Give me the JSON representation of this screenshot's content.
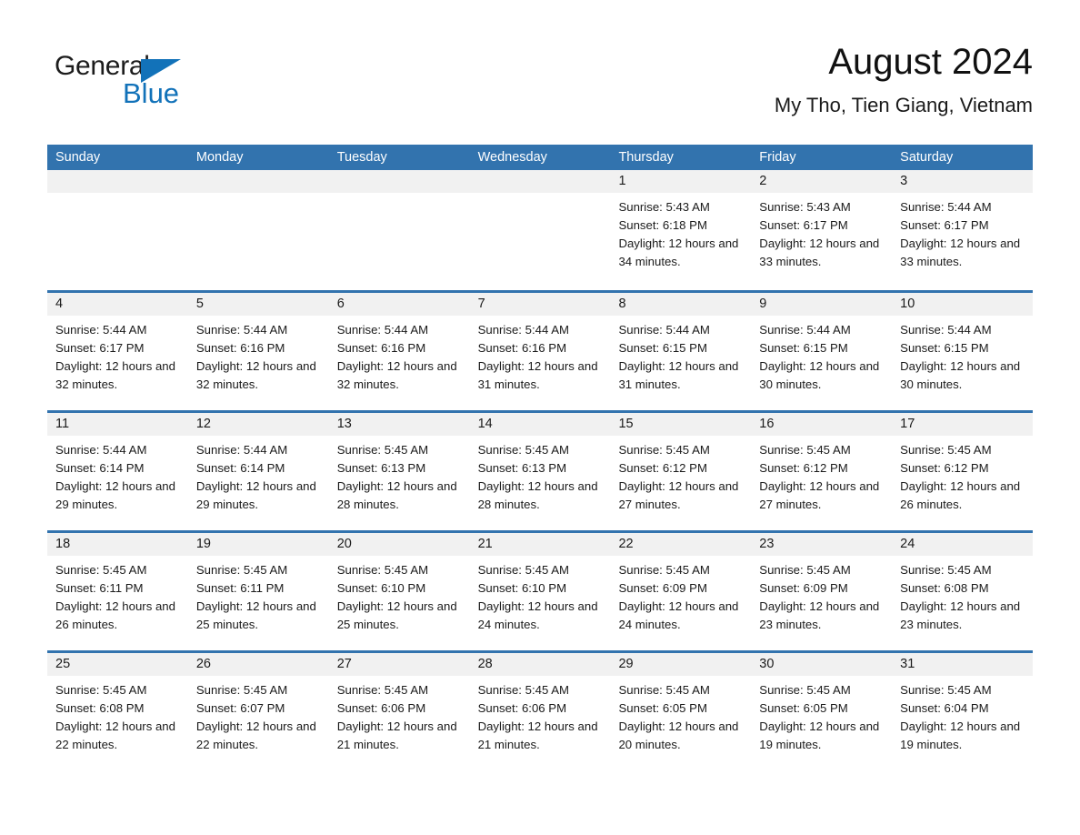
{
  "brand": {
    "line1": "General",
    "line2": "Blue",
    "triangle_color": "#1272b9"
  },
  "header": {
    "title": "August 2024",
    "subtitle": "My Tho, Tien Giang, Vietnam"
  },
  "theme": {
    "header_blue": "#3273ae",
    "day_number_bg": "#f1f1f1",
    "text": "#1a1a1a"
  },
  "weekdays": [
    "Sunday",
    "Monday",
    "Tuesday",
    "Wednesday",
    "Thursday",
    "Friday",
    "Saturday"
  ],
  "weeks": [
    [
      {
        "day": "",
        "sunrise": "",
        "sunset": "",
        "daylight": ""
      },
      {
        "day": "",
        "sunrise": "",
        "sunset": "",
        "daylight": ""
      },
      {
        "day": "",
        "sunrise": "",
        "sunset": "",
        "daylight": ""
      },
      {
        "day": "",
        "sunrise": "",
        "sunset": "",
        "daylight": ""
      },
      {
        "day": "1",
        "sunrise": "Sunrise: 5:43 AM",
        "sunset": "Sunset: 6:18 PM",
        "daylight": "Daylight: 12 hours and 34 minutes."
      },
      {
        "day": "2",
        "sunrise": "Sunrise: 5:43 AM",
        "sunset": "Sunset: 6:17 PM",
        "daylight": "Daylight: 12 hours and 33 minutes."
      },
      {
        "day": "3",
        "sunrise": "Sunrise: 5:44 AM",
        "sunset": "Sunset: 6:17 PM",
        "daylight": "Daylight: 12 hours and 33 minutes."
      }
    ],
    [
      {
        "day": "4",
        "sunrise": "Sunrise: 5:44 AM",
        "sunset": "Sunset: 6:17 PM",
        "daylight": "Daylight: 12 hours and 32 minutes."
      },
      {
        "day": "5",
        "sunrise": "Sunrise: 5:44 AM",
        "sunset": "Sunset: 6:16 PM",
        "daylight": "Daylight: 12 hours and 32 minutes."
      },
      {
        "day": "6",
        "sunrise": "Sunrise: 5:44 AM",
        "sunset": "Sunset: 6:16 PM",
        "daylight": "Daylight: 12 hours and 32 minutes."
      },
      {
        "day": "7",
        "sunrise": "Sunrise: 5:44 AM",
        "sunset": "Sunset: 6:16 PM",
        "daylight": "Daylight: 12 hours and 31 minutes."
      },
      {
        "day": "8",
        "sunrise": "Sunrise: 5:44 AM",
        "sunset": "Sunset: 6:15 PM",
        "daylight": "Daylight: 12 hours and 31 minutes."
      },
      {
        "day": "9",
        "sunrise": "Sunrise: 5:44 AM",
        "sunset": "Sunset: 6:15 PM",
        "daylight": "Daylight: 12 hours and 30 minutes."
      },
      {
        "day": "10",
        "sunrise": "Sunrise: 5:44 AM",
        "sunset": "Sunset: 6:15 PM",
        "daylight": "Daylight: 12 hours and 30 minutes."
      }
    ],
    [
      {
        "day": "11",
        "sunrise": "Sunrise: 5:44 AM",
        "sunset": "Sunset: 6:14 PM",
        "daylight": "Daylight: 12 hours and 29 minutes."
      },
      {
        "day": "12",
        "sunrise": "Sunrise: 5:44 AM",
        "sunset": "Sunset: 6:14 PM",
        "daylight": "Daylight: 12 hours and 29 minutes."
      },
      {
        "day": "13",
        "sunrise": "Sunrise: 5:45 AM",
        "sunset": "Sunset: 6:13 PM",
        "daylight": "Daylight: 12 hours and 28 minutes."
      },
      {
        "day": "14",
        "sunrise": "Sunrise: 5:45 AM",
        "sunset": "Sunset: 6:13 PM",
        "daylight": "Daylight: 12 hours and 28 minutes."
      },
      {
        "day": "15",
        "sunrise": "Sunrise: 5:45 AM",
        "sunset": "Sunset: 6:12 PM",
        "daylight": "Daylight: 12 hours and 27 minutes."
      },
      {
        "day": "16",
        "sunrise": "Sunrise: 5:45 AM",
        "sunset": "Sunset: 6:12 PM",
        "daylight": "Daylight: 12 hours and 27 minutes."
      },
      {
        "day": "17",
        "sunrise": "Sunrise: 5:45 AM",
        "sunset": "Sunset: 6:12 PM",
        "daylight": "Daylight: 12 hours and 26 minutes."
      }
    ],
    [
      {
        "day": "18",
        "sunrise": "Sunrise: 5:45 AM",
        "sunset": "Sunset: 6:11 PM",
        "daylight": "Daylight: 12 hours and 26 minutes."
      },
      {
        "day": "19",
        "sunrise": "Sunrise: 5:45 AM",
        "sunset": "Sunset: 6:11 PM",
        "daylight": "Daylight: 12 hours and 25 minutes."
      },
      {
        "day": "20",
        "sunrise": "Sunrise: 5:45 AM",
        "sunset": "Sunset: 6:10 PM",
        "daylight": "Daylight: 12 hours and 25 minutes."
      },
      {
        "day": "21",
        "sunrise": "Sunrise: 5:45 AM",
        "sunset": "Sunset: 6:10 PM",
        "daylight": "Daylight: 12 hours and 24 minutes."
      },
      {
        "day": "22",
        "sunrise": "Sunrise: 5:45 AM",
        "sunset": "Sunset: 6:09 PM",
        "daylight": "Daylight: 12 hours and 24 minutes."
      },
      {
        "day": "23",
        "sunrise": "Sunrise: 5:45 AM",
        "sunset": "Sunset: 6:09 PM",
        "daylight": "Daylight: 12 hours and 23 minutes."
      },
      {
        "day": "24",
        "sunrise": "Sunrise: 5:45 AM",
        "sunset": "Sunset: 6:08 PM",
        "daylight": "Daylight: 12 hours and 23 minutes."
      }
    ],
    [
      {
        "day": "25",
        "sunrise": "Sunrise: 5:45 AM",
        "sunset": "Sunset: 6:08 PM",
        "daylight": "Daylight: 12 hours and 22 minutes."
      },
      {
        "day": "26",
        "sunrise": "Sunrise: 5:45 AM",
        "sunset": "Sunset: 6:07 PM",
        "daylight": "Daylight: 12 hours and 22 minutes."
      },
      {
        "day": "27",
        "sunrise": "Sunrise: 5:45 AM",
        "sunset": "Sunset: 6:06 PM",
        "daylight": "Daylight: 12 hours and 21 minutes."
      },
      {
        "day": "28",
        "sunrise": "Sunrise: 5:45 AM",
        "sunset": "Sunset: 6:06 PM",
        "daylight": "Daylight: 12 hours and 21 minutes."
      },
      {
        "day": "29",
        "sunrise": "Sunrise: 5:45 AM",
        "sunset": "Sunset: 6:05 PM",
        "daylight": "Daylight: 12 hours and 20 minutes."
      },
      {
        "day": "30",
        "sunrise": "Sunrise: 5:45 AM",
        "sunset": "Sunset: 6:05 PM",
        "daylight": "Daylight: 12 hours and 19 minutes."
      },
      {
        "day": "31",
        "sunrise": "Sunrise: 5:45 AM",
        "sunset": "Sunset: 6:04 PM",
        "daylight": "Daylight: 12 hours and 19 minutes."
      }
    ]
  ]
}
